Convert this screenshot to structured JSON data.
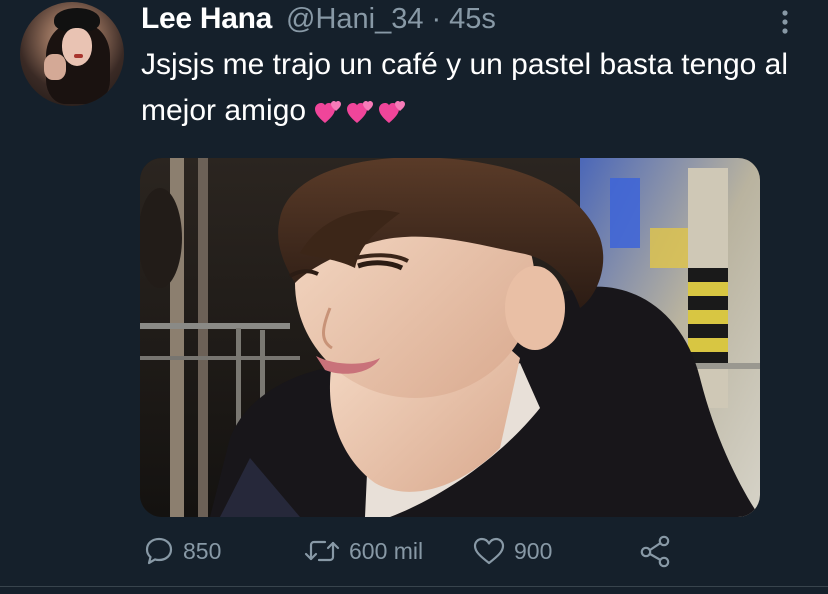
{
  "tweet": {
    "author_name": "Lee Hana",
    "handle": "@Hani_34",
    "separator": "·",
    "time": "45s",
    "text": "Jsjsjs me trajo un café y un pastel basta tengo al mejor amigo",
    "emoji": [
      "two-hearts",
      "two-hearts",
      "two-hearts"
    ],
    "media": {
      "description_icon": "photo"
    },
    "actions": {
      "replies": "850",
      "retweets": "600 mil",
      "likes": "900"
    }
  },
  "icons": {
    "reply": "speech-bubble-icon",
    "retweet": "retweet-arrows-icon",
    "like": "heart-outline-icon",
    "share": "share-nodes-icon",
    "more": "vertical-ellipsis-icon"
  },
  "colors": {
    "background": "#15202b",
    "primary_text": "#ffffff",
    "secondary_text": "#8899a6",
    "divider": "#38444d",
    "heart_emoji": "#f0459a"
  }
}
